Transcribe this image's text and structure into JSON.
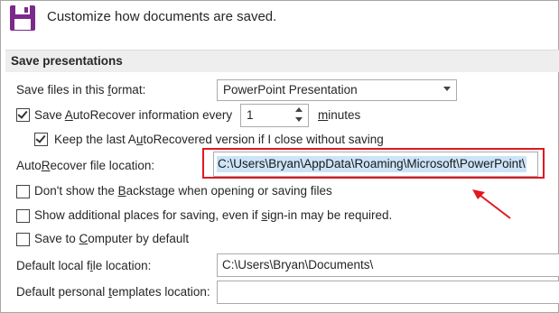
{
  "header": {
    "title": "Customize how documents are saved.",
    "icon": "floppy-disk-icon",
    "icon_color": "#7a2a8a"
  },
  "section": {
    "title": "Save presentations"
  },
  "format": {
    "label": "Save files in this format:",
    "value": "PowerPoint Presentation"
  },
  "autorecover": {
    "label": "Save AutoRecover information every",
    "checked": true,
    "value": "1",
    "unit": "minutes"
  },
  "keep_last": {
    "label": "Keep the last AutoRecovered version if I close without saving",
    "checked": true
  },
  "autorecover_location": {
    "label": "AutoRecover file location:",
    "value": "C:\\Users\\Bryan\\AppData\\Roaming\\Microsoft\\PowerPoint\\"
  },
  "options": [
    {
      "label": "Don't show the Backstage when opening or saving files",
      "checked": false
    },
    {
      "label": "Show additional places for saving, even if sign-in may be required.",
      "checked": false
    },
    {
      "label": "Save to Computer by default",
      "checked": false
    }
  ],
  "default_local": {
    "label": "Default local file location:",
    "value": "C:\\Users\\Bryan\\Documents\\"
  },
  "personal_templates": {
    "label": "Default personal templates location:",
    "value": ""
  },
  "highlight_color": "#e0191f",
  "selection_color": "#cce4f7"
}
